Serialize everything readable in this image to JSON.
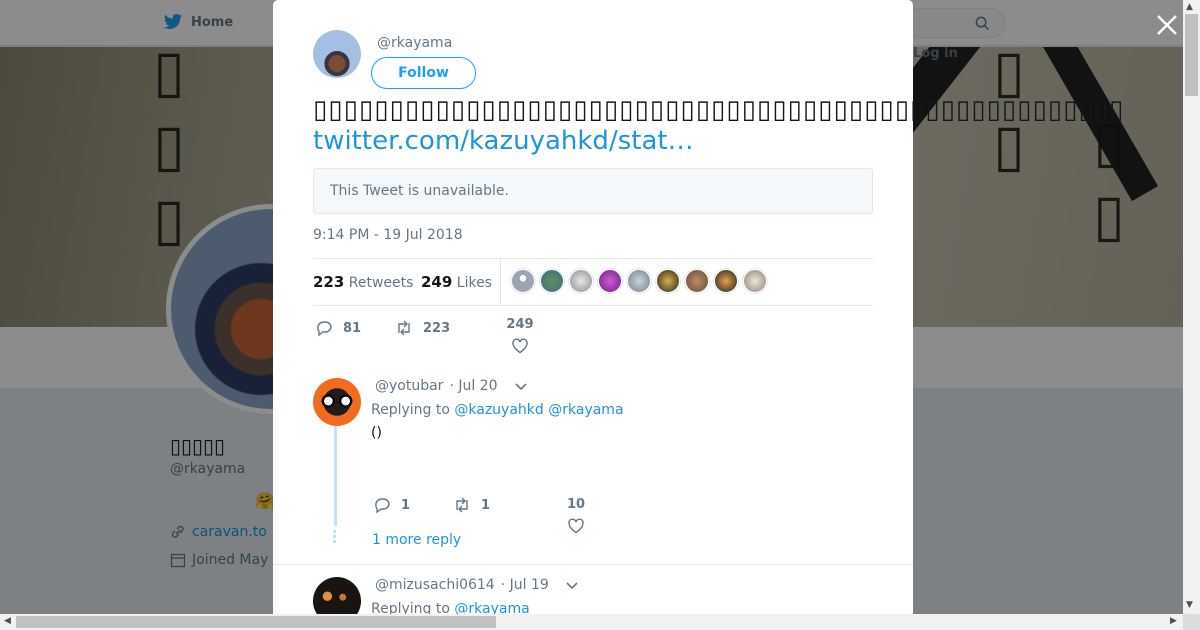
{
  "background": {
    "nav_home": "Home",
    "login": "Log in",
    "profile_name": "▯▯▯▯▯",
    "profile_handle": "@rkayama",
    "profile_emoji": "🤗",
    "profile_link": "caravan.to",
    "joined": "Joined May"
  },
  "tweet": {
    "handle": "@rkayama",
    "follow_label": "Follow",
    "text": "▯▯▯▯▯▯▯▯▯▯▯▯▯▯▯▯▯▯▯▯▯▯▯▯▯▯▯▯▯▯▯▯▯▯▯▯▯▯▯▯▯▯▯▯▯▯▯▯▯▯▯▯▯",
    "link": "twitter.com/kazuyahkd/stat…",
    "quote_unavailable": "This Tweet is unavailable.",
    "time": "9:14 PM - 19 Jul 2018",
    "retweets_count": "223",
    "retweets_label": "Retweets",
    "likes_count": "249",
    "likes_label": "Likes",
    "actions": {
      "replies": "81",
      "retweets": "223",
      "likes": "249"
    }
  },
  "replies": [
    {
      "handle": "@yotubar",
      "date": "· Jul 20",
      "replying_prefix": "Replying to",
      "replying_to_1": "@kazuyahkd",
      "replying_to_2": "@rkayama",
      "body": "()",
      "actions": {
        "replies": "1",
        "retweets": "1",
        "likes": "10"
      },
      "more_replies": "1 more reply"
    },
    {
      "handle": "@mizusachi0614",
      "date": "· Jul 19",
      "replying_prefix": "Replying to",
      "replying_to_1": "@rkayama"
    }
  ],
  "colors": {
    "link": "#1b95e0",
    "accent": "#1da1f2",
    "muted": "#657786",
    "thread": "#bfe3f9"
  }
}
